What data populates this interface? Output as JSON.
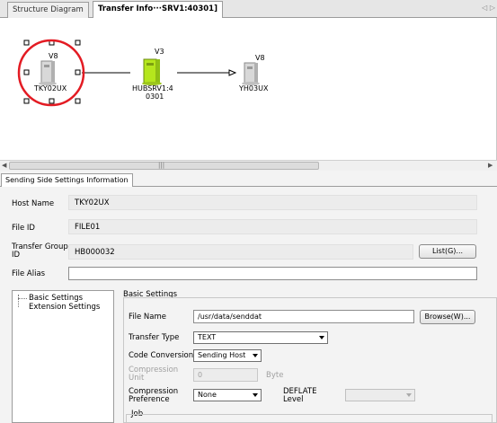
{
  "tabs": [
    {
      "label": "Structure Diagram"
    },
    {
      "label": "Transfer Info···SRV1:40301]"
    }
  ],
  "tab_scroll_arrows": "◁ ▷",
  "diagram": {
    "nodes": [
      {
        "version": "V8",
        "name": "TKY02UX"
      },
      {
        "version": "V3",
        "name_line1": "HUBSRV1:4",
        "name_line2": "0301"
      },
      {
        "version": "V8",
        "name": "YH03UX"
      }
    ]
  },
  "scrollbar": {
    "thumb_grip": "|||"
  },
  "panel_tab": "Sending Side Settings Information",
  "form": {
    "host_name_label": "Host Name",
    "host_name_value": "TKY02UX",
    "file_id_label": "File ID",
    "file_id_value": "FILE01",
    "transfer_group_label_1": "Transfer Group",
    "transfer_group_label_2": "ID",
    "transfer_group_value": "HB000032",
    "list_button": "List(G)...",
    "file_alias_label": "File Alias",
    "file_alias_value": ""
  },
  "tree": {
    "items": [
      "Basic Settings",
      "Extension Settings"
    ]
  },
  "basic": {
    "group_title": "Basic Settings",
    "file_name_label": "File Name",
    "file_name_value": "/usr/data/senddat",
    "browse_button": "Browse(W)...",
    "transfer_type_label": "Transfer Type",
    "transfer_type_value": "TEXT",
    "code_conversion_label": "Code Conversion",
    "code_conversion_value": "Sending Host",
    "compression_unit_label_1": "Compression",
    "compression_unit_label_2": "Unit",
    "compression_unit_value": "0",
    "compression_unit_suffix": "Byte",
    "compression_pref_label_1": "Compression",
    "compression_pref_label_2": "Preference",
    "compression_pref_value": "None",
    "deflate_label_1": "DEFLATE",
    "deflate_label_2": "Level",
    "deflate_value": "",
    "job_label": "Job"
  },
  "colors": {
    "selection_circle": "#e31b23",
    "server_green": "#b5e61d"
  }
}
